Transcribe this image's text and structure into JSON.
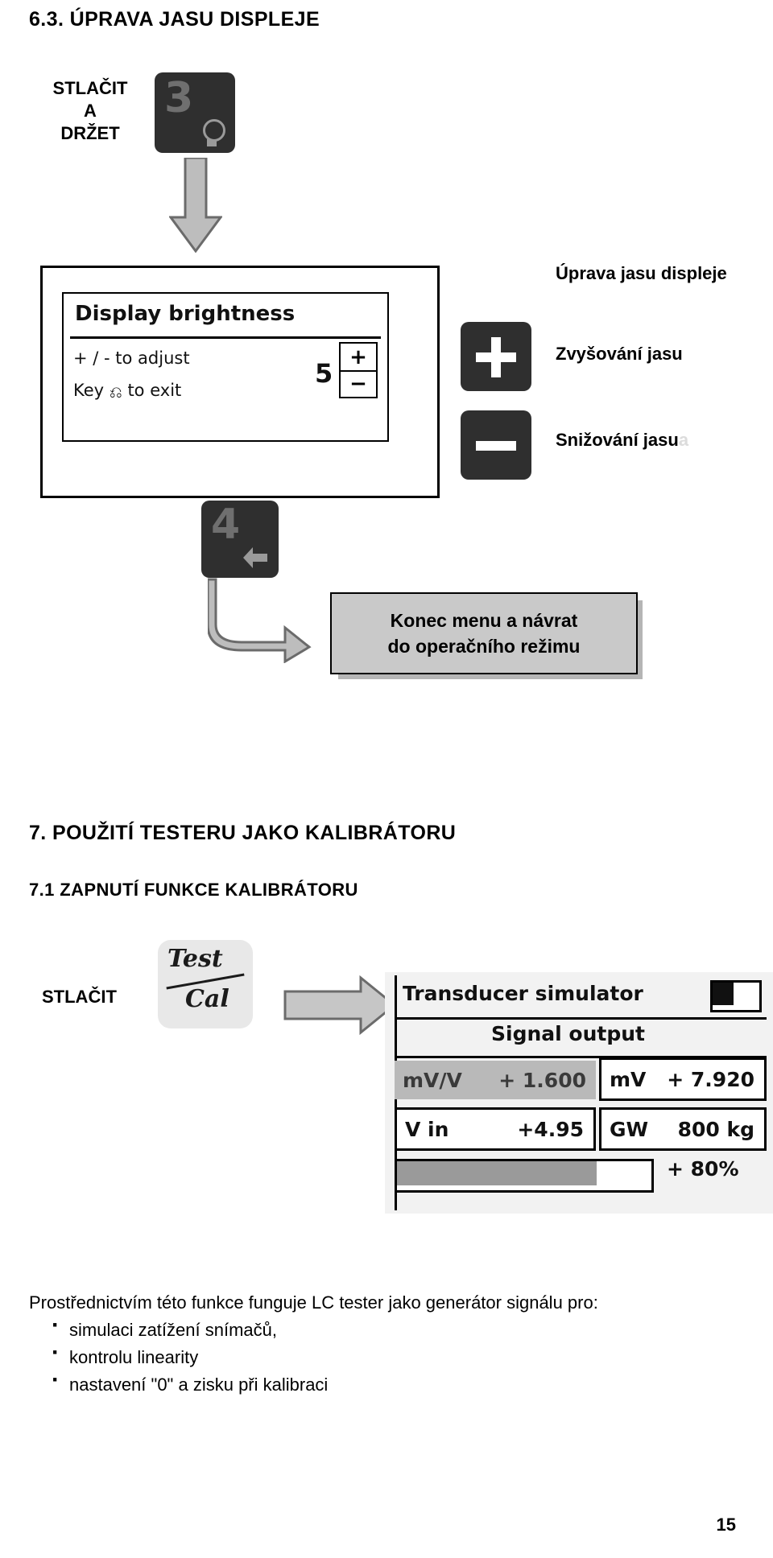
{
  "sections": {
    "s63": "6.3. ÚPRAVA JASU DISPLEJE",
    "s7": "7. POUŽITÍ TESTERU JAKO KALIBRÁTORU",
    "s71": "7.1 ZAPNUTÍ FUNKCE KALIBRÁTORU"
  },
  "diagram_brightness": {
    "press_hold": {
      "l1": "STLAČIT",
      "l2": "A",
      "l3": "DRŽET"
    },
    "key3": {
      "number": "3"
    },
    "key4": {
      "number": "4"
    },
    "display": {
      "title": "Display brightness",
      "line1": "+ / - to adjust",
      "line2_prefix": "Key",
      "line2_suffix": "to exit",
      "value": "5",
      "plus": "+",
      "minus": "−"
    },
    "labels": {
      "uprava_jasu": "Úprava jasu displeje",
      "zvysovani": "Zvyšování jasu",
      "snizovani": "Snižování jasu",
      "snizovani_tail": "a"
    },
    "exit_box": {
      "l1": "Konec menu a návrat",
      "l2": "do operačního režimu"
    }
  },
  "diagram_calibrator": {
    "press_label": "STLAČIT",
    "testcal_key": {
      "top": "Test",
      "bottom": "Cal"
    },
    "display": {
      "title": "Transducer simulator",
      "signal_output": "Signal output",
      "mvv_unit": "mV/V",
      "mvv_value": "+ 1.600",
      "mv_unit": "mV",
      "mv_value": "+ 7.920",
      "vin_unit": "V in",
      "vin_value": "+4.95",
      "gw_unit": "GW",
      "gw_value": "800 kg",
      "percent": "+ 80%",
      "bar_fill_percent": 80
    }
  },
  "body": {
    "lead": "Prostřednictvím této funkce funguje LC tester jako generátor signálu pro:",
    "bullets": [
      "simulaci zatížení snímačů,",
      "kontrolu linearity",
      "nastavení \"0\" a zisku při kalibraci"
    ]
  },
  "page_number": "15"
}
